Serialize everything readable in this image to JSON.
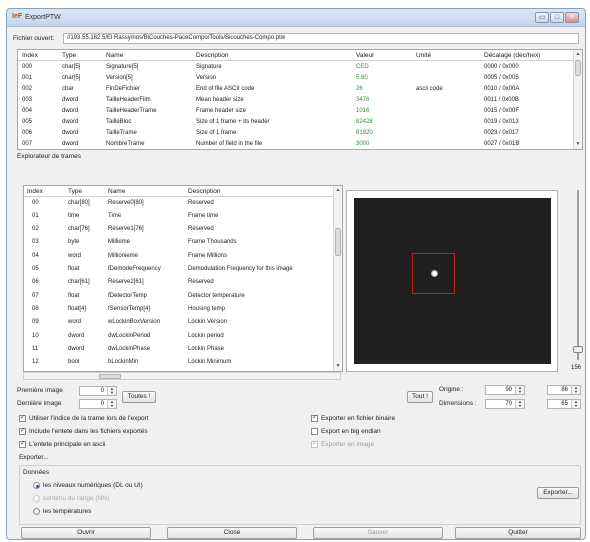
{
  "window": {
    "app_icon": "IeF",
    "title": "ExportPTW",
    "min": "▭",
    "max": "□",
    "close": "✕"
  },
  "file": {
    "label": "Fichier ouvert:",
    "path": "//193.55.162.5/El Rassy/nos/BiCouches-PaceCompo/Tools/Bicouches-Compo.ptw"
  },
  "header_table": {
    "columns": [
      "Index",
      "Type",
      "Name",
      "Description",
      "Valeur",
      "Unité",
      "Décalage (dec/hex)"
    ],
    "rows": [
      [
        "000",
        "char[5]",
        "Signature[5]",
        "Signature",
        "CED",
        "",
        "0000 / 0x000"
      ],
      [
        "001",
        "char[5]",
        "Version[5]",
        "Version",
        "5.60",
        "",
        "0005 / 0x005"
      ],
      [
        "002",
        "char",
        "FinDeFichier",
        "End of file ASCII code",
        "26",
        "ascii code",
        "0010 / 0x00A"
      ],
      [
        "003",
        "dword",
        "TailleHeaderFilm",
        "Mean header size",
        "3476",
        "",
        "0011 / 0x00B"
      ],
      [
        "004",
        "dword",
        "TailleHeaderTrame",
        "Frame header size",
        "1016",
        "",
        "0015 / 0x00F"
      ],
      [
        "005",
        "dword",
        "TailleBloc",
        "Size of 1 frame + its header",
        "82428",
        "",
        "0019 / 0x013"
      ],
      [
        "006",
        "dword",
        "TailleTrame",
        "Size of 1 frame",
        "81920",
        "",
        "0023 / 0x017"
      ],
      [
        "007",
        "dword",
        "NombreTrame",
        "Number of field in the file",
        "3000",
        "",
        "0027 / 0x01B"
      ]
    ]
  },
  "frame_explorer": {
    "label": "Explorateur de trames",
    "columns": [
      "Index",
      "Type",
      "Name",
      "Description"
    ],
    "rows": [
      [
        "00",
        "char[80]",
        "Reserve0[80]",
        "Reserved"
      ],
      [
        "01",
        "time",
        "Time",
        "Frame time"
      ],
      [
        "02",
        "char[76]",
        "Reserve1[76]",
        "Reserved"
      ],
      [
        "03",
        "byte",
        "Millieme",
        "Frame Thousands"
      ],
      [
        "04",
        "word",
        "Millionieme",
        "Frame Millions"
      ],
      [
        "05",
        "float",
        "fDemodeFrequency",
        "Demodulation Frequency for this image"
      ],
      [
        "06",
        "char[61]",
        "Reserve2[61]",
        "Reserved"
      ],
      [
        "07",
        "float",
        "fDetectorTemp",
        "Detector temperature"
      ],
      [
        "08",
        "float[4]",
        "fSensorTemp[4]",
        "Housing temp"
      ],
      [
        "09",
        "word",
        "wLockinBoxVersion",
        "Lockin Version"
      ],
      [
        "10",
        "dword",
        "dwLockinPeriod",
        "Lockin period"
      ],
      [
        "11",
        "dword",
        "dwLockinPhase",
        "Lockin Phase"
      ],
      [
        "12",
        "bool",
        "bLockinMin",
        "Lockin Minimum"
      ]
    ],
    "slider_value": "156"
  },
  "controls": {
    "first_image_label": "Première image",
    "first_image_value": "0",
    "last_image_label": "Dernière image",
    "last_image_value": "0",
    "all_button": "Toutes !",
    "all2_button": "Tout !",
    "origin_label": "Origine :",
    "origin_x": "90",
    "origin_y": "86",
    "dims_label": "Dimensions :",
    "dims_x": "70",
    "dims_y": "65",
    "cb_use_index": "Utiliser l'indice de la trame lors de l'export",
    "cb_include_header": "Include l'entete dans les fichiers exportés",
    "cb_main_header": "L'entete principale en ascii",
    "cb_export_binary": "Exporter en fichier binaire",
    "cb_big_endian": "Export en big endian",
    "cb_export_image": "Exporter en image",
    "export_group": "Exporter...",
    "data_group": "Données",
    "radio_levels": "les niveaux numériques (DL ou UI)",
    "radio_range": "contenu du range (NN)",
    "radio_temps": "les températures",
    "export_button": "Exporter..."
  },
  "footer": {
    "open": "Ouvrir",
    "close": "Close",
    "save": "Sauver",
    "quit": "Quitter"
  }
}
